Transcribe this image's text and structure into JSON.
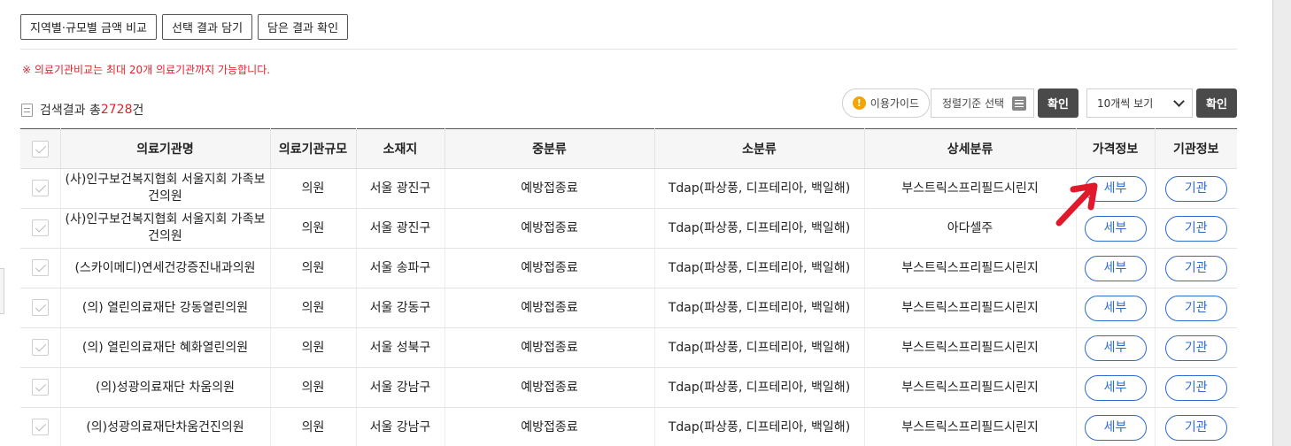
{
  "top_buttons": [
    {
      "label": "지역별·규모별 금액 비교"
    },
    {
      "label": "선택 결과 담기"
    },
    {
      "label": "담은 결과 확인"
    }
  ],
  "notice": "※ 의료기관비교는 최대 20개 의료기관까지 가능합니다.",
  "result": {
    "prefix": "검색결과 총",
    "count": "2728",
    "suffix": "건"
  },
  "toolbar": {
    "guide_label": "이용가이드",
    "sort_label": "정렬기준 선택",
    "confirm_label": "확인",
    "per_page_value": "10개씩 보기",
    "confirm2_label": "확인"
  },
  "table": {
    "headers": [
      "의료기관명",
      "의료기관규모",
      "소재지",
      "중분류",
      "소분류",
      "상세분류",
      "가격정보",
      "기관정보"
    ],
    "rows": [
      {
        "name": "(사)인구보건복지협회 서울지회 가족보건의원",
        "scale": "의원",
        "location": "서울 광진구",
        "mid": "예방접종료",
        "small": "Tdap(파상풍, 디프테리아, 백일해)",
        "detail": "부스트릭스프리필드시린지",
        "price_btn": "세부",
        "org_btn": "기관"
      },
      {
        "name": "(사)인구보건복지협회 서울지회 가족보건의원",
        "scale": "의원",
        "location": "서울 광진구",
        "mid": "예방접종료",
        "small": "Tdap(파상풍, 디프테리아, 백일해)",
        "detail": "아다셀주",
        "price_btn": "세부",
        "org_btn": "기관"
      },
      {
        "name": "(스카이메디)연세건강증진내과의원",
        "scale": "의원",
        "location": "서울 송파구",
        "mid": "예방접종료",
        "small": "Tdap(파상풍, 디프테리아, 백일해)",
        "detail": "부스트릭스프리필드시린지",
        "price_btn": "세부",
        "org_btn": "기관"
      },
      {
        "name": "(의) 열린의료재단 강동열린의원",
        "scale": "의원",
        "location": "서울 강동구",
        "mid": "예방접종료",
        "small": "Tdap(파상풍, 디프테리아, 백일해)",
        "detail": "부스트릭스프리필드시린지",
        "price_btn": "세부",
        "org_btn": "기관"
      },
      {
        "name": "(의) 열린의료재단 혜화열린의원",
        "scale": "의원",
        "location": "서울 성북구",
        "mid": "예방접종료",
        "small": "Tdap(파상풍, 디프테리아, 백일해)",
        "detail": "부스트릭스프리필드시린지",
        "price_btn": "세부",
        "org_btn": "기관"
      },
      {
        "name": "(의)성광의료재단 차움의원",
        "scale": "의원",
        "location": "서울 강남구",
        "mid": "예방접종료",
        "small": "Tdap(파상풍, 디프테리아, 백일해)",
        "detail": "부스트릭스프리필드시린지",
        "price_btn": "세부",
        "org_btn": "기관"
      },
      {
        "name": "(의)성광의료재단차움건진의원",
        "scale": "의원",
        "location": "서울 강남구",
        "mid": "예방접종료",
        "small": "Tdap(파상풍, 디프테리아, 백일해)",
        "detail": "부스트릭스프리필드시린지",
        "price_btn": "세부",
        "org_btn": "기관"
      }
    ]
  },
  "colors": {
    "accent_red": "#d9272e",
    "pill_blue": "#2e6bd1",
    "arrow_red": "#e0192b"
  },
  "icons": {
    "guide": "info-icon",
    "sort": "list-icon",
    "per_page": "chevron-down-icon",
    "result": "document-icon"
  }
}
